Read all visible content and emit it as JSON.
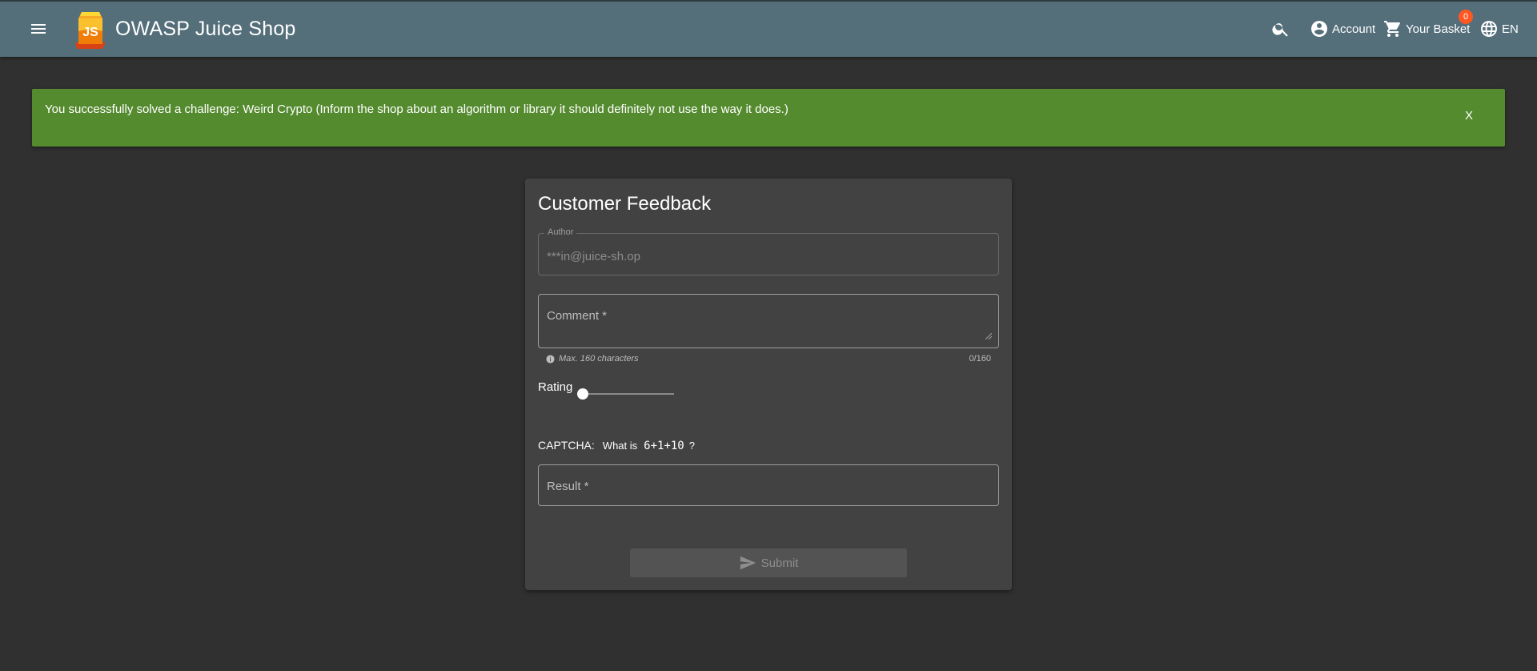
{
  "toolbar": {
    "menu_icon": "menu-icon",
    "app_title": "OWASP Juice Shop",
    "search_icon": "search-icon",
    "account_label": "Account",
    "basket_label": "Your Basket",
    "basket_count": "0",
    "language_label": "EN"
  },
  "snackbar": {
    "message": "You successfully solved a challenge: Weird Crypto (Inform the shop about an algorithm or library it should definitely not use the way it does.)",
    "close_label": "X",
    "color": "#558b2f"
  },
  "feedback": {
    "title": "Customer Feedback",
    "author_label": "Author",
    "author_value": "***in@juice-sh.op",
    "comment_placeholder": "Comment *",
    "comment_hint": "Max. 160 characters",
    "comment_count": "0/160",
    "rating_label": "Rating",
    "rating_value": 0,
    "captcha_label": "CAPTCHA:",
    "captcha_question": "What is",
    "captcha_expression": "6+1+10",
    "captcha_qmark": "?",
    "result_placeholder": "Result *",
    "submit_label": "Submit"
  },
  "colors": {
    "toolbar": "#546e7a",
    "background": "#303030",
    "card": "#424242",
    "badge": "#ff5722"
  }
}
